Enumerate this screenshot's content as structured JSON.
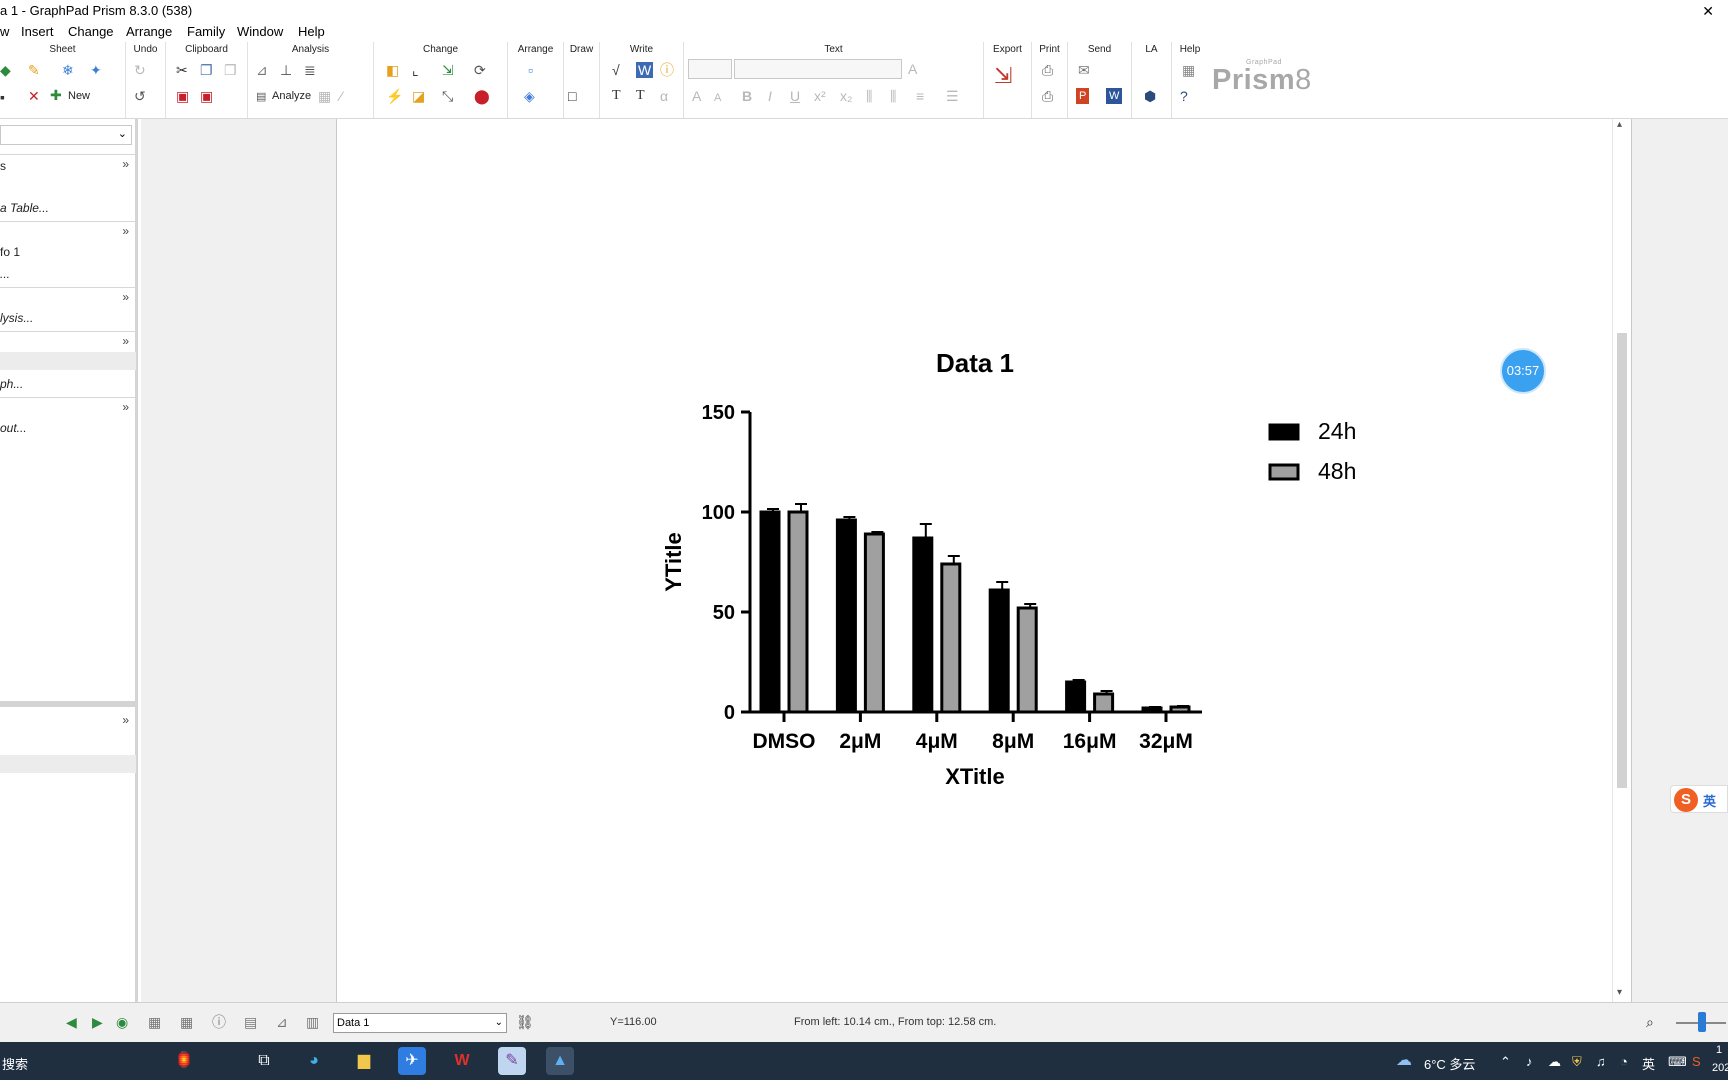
{
  "window": {
    "title": "a 1 - GraphPad Prism 8.3.0 (538)",
    "close_glyph": "✕"
  },
  "menu": [
    "w",
    "Insert",
    "Change",
    "Arrange",
    "Family",
    "Window",
    "Help"
  ],
  "ribbon": {
    "groups": [
      "Sheet",
      "Undo",
      "Clipboard",
      "Analysis",
      "Change",
      "Arrange",
      "Draw",
      "Write",
      "Text",
      "Export",
      "Print",
      "Send",
      "LA",
      "Help"
    ],
    "new_label": "New",
    "analyze_label": "Analyze",
    "logo_text": "Prism",
    "logo_version": "8",
    "logo_small": "GraphPad"
  },
  "left_panel": {
    "items": [
      "s",
      "a Table...",
      "fo 1",
      "...",
      "lysis...",
      "ph...",
      "out..."
    ]
  },
  "timer": "03:57",
  "sogou": {
    "logo": "S",
    "label": "英"
  },
  "status": {
    "sheet_selector": "Data 1",
    "y_readout": "Y=116.00",
    "position_readout": "From left: 10.14 cm., From top: 12.58 cm."
  },
  "taskbar": {
    "search_label": "搜索",
    "weather": "6°C 多云",
    "ime": "英",
    "clock_partial": "1",
    "date_partial": "202"
  },
  "chart_data": {
    "type": "bar",
    "title": "Data 1",
    "xlabel": "XTitle",
    "ylabel": "YTitle",
    "ylim": [
      0,
      150
    ],
    "yticks": [
      "0",
      "50",
      "100",
      "150"
    ],
    "categories": [
      "DMSO",
      "2μM",
      "4μM",
      "8μM",
      "16μM",
      "32μM"
    ],
    "series": [
      {
        "name": "24h",
        "values": [
          100,
          96,
          87,
          61,
          15,
          2
        ],
        "errors": [
          1.5,
          1.5,
          7,
          4,
          1,
          0.5
        ],
        "fill": "#000000"
      },
      {
        "name": "48h",
        "values": [
          100,
          89,
          74,
          52,
          9,
          2.5
        ],
        "errors": [
          4,
          1,
          4,
          2,
          1.5,
          0.5
        ],
        "fill": "#a0a0a0"
      }
    ],
    "legend_position": "top-right"
  }
}
